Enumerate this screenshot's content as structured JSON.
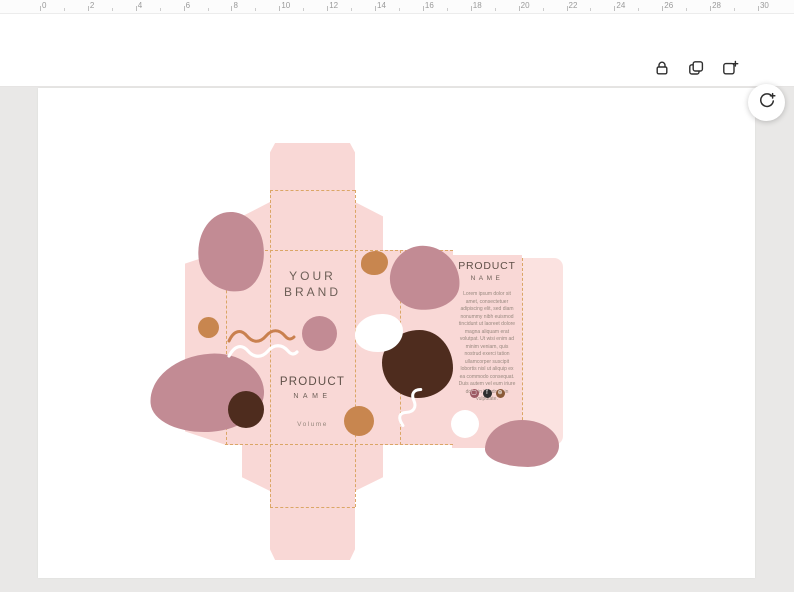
{
  "ruler": {
    "labels": [
      "0",
      "2",
      "4",
      "6",
      "8",
      "10",
      "12",
      "14",
      "16",
      "18",
      "20",
      "22",
      "24",
      "26",
      "28",
      "30"
    ]
  },
  "toolbar": {
    "icons": [
      "lock-icon",
      "duplicate-icon",
      "add-page-icon"
    ]
  },
  "floating_button": {
    "icon": "assistant-icon"
  },
  "design": {
    "brand_line1": "YOUR",
    "brand_line2": "BRAND",
    "front_product": "PRODUCT",
    "front_name": "NAME",
    "front_volume": "Volume",
    "back_product": "PRODUCT",
    "back_name": "NAME",
    "back_body": "Lorem ipsum dolor sit amet, consectetuer adipiscing elit, sed diam nonummy nibh euismod tincidunt ut laoreet dolore magna aliquam erat volutpat. Ut wisi enim ad minim veniam, quis nostrud exerci tation ullamcorper suscipit lobortis nisl ut aliquip ex ea commodo consequat. Duis autem vel eum iriure dolor in hendrerit in vulputate."
  },
  "social": [
    {
      "name": "instagram-icon",
      "glyph": "▢"
    },
    {
      "name": "facebook-icon",
      "glyph": "f"
    },
    {
      "name": "globe-icon",
      "glyph": "⊕"
    }
  ],
  "colors": {
    "pink": "#f9d8d6",
    "pink_light": "#fbe2e0",
    "mauve": "#c28b94",
    "brown": "#4e2c1e",
    "tan": "#c8864f",
    "terracotta": "#c9804f",
    "dash": "#dba666",
    "text_dark": "#5f5048",
    "text_mid": "#6d5f57",
    "text_light": "#98897f",
    "canvas_bg": "#e9e8e7"
  }
}
